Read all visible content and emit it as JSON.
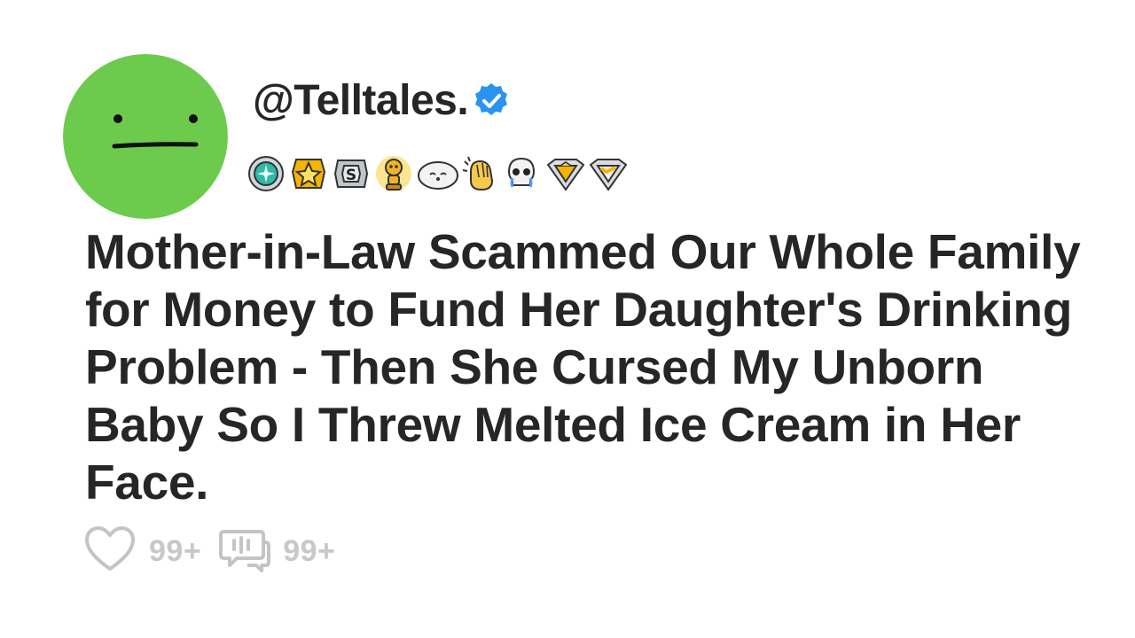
{
  "post": {
    "username": "@Telltales.",
    "verified": true,
    "title": "Mother-in-Law Scammed Our Whole Family for Money to Fund Her Daughter's Drinking Problem - Then She Cursed My Unborn Baby So I Threw Melted Ice Cream in Her Face.",
    "likes": "99+",
    "comments": "99+"
  },
  "avatar": {
    "color": "#6ccb4d",
    "face": "neutral-face"
  },
  "awards": [
    {
      "icon": "teal-medal-award-icon"
    },
    {
      "icon": "gold-star-award-icon"
    },
    {
      "icon": "silver-s-award-icon"
    },
    {
      "icon": "golden-alien-trophy-award-icon"
    },
    {
      "icon": "seal-award-icon"
    },
    {
      "icon": "clapping-hands-award-icon"
    },
    {
      "icon": "skull-tears-award-icon"
    },
    {
      "icon": "gold-diamond-shield-award-icon"
    },
    {
      "icon": "platinum-shield-award-icon"
    }
  ],
  "colors": {
    "text": "#262626",
    "muted": "#c4c4c4",
    "verified": "#2a93f0",
    "avatar": "#6ccb4d"
  }
}
